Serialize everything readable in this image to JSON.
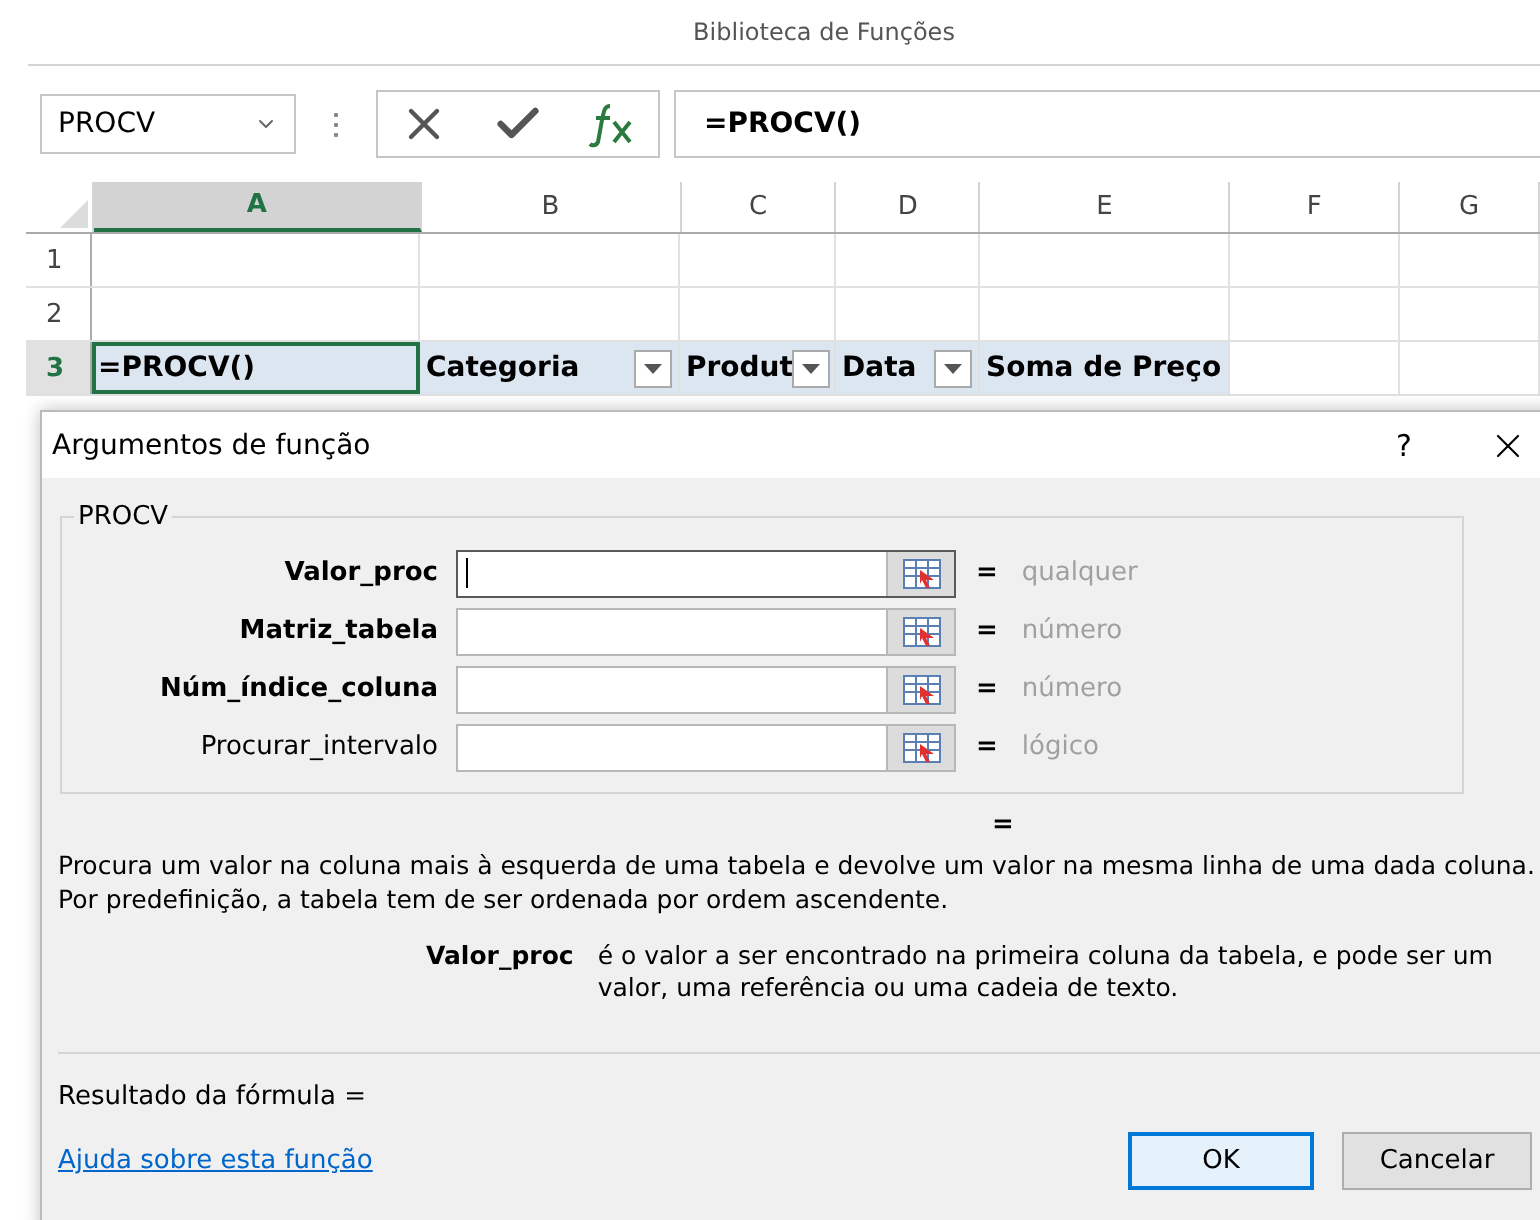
{
  "ribbon_group": "Biblioteca de Funções",
  "name_box": "PROCV",
  "formula_bar": {
    "value": "=PROCV()"
  },
  "columns": [
    {
      "label": "A",
      "selected": true
    },
    {
      "label": "B",
      "selected": false
    },
    {
      "label": "C",
      "selected": false
    },
    {
      "label": "D",
      "selected": false
    },
    {
      "label": "E",
      "selected": false
    },
    {
      "label": "F",
      "selected": false
    },
    {
      "label": "G",
      "selected": false
    }
  ],
  "rows": [
    {
      "number": "1",
      "selected": false,
      "cells": []
    },
    {
      "number": "2",
      "selected": false,
      "cells": []
    },
    {
      "number": "3",
      "selected": true,
      "cells": [
        {
          "text": "=PROCV()",
          "kind": "active"
        },
        {
          "text": "Categoria",
          "kind": "filter"
        },
        {
          "text": "Produt",
          "kind": "filter"
        },
        {
          "text": "Data",
          "kind": "filter"
        },
        {
          "text": "Soma de Preço",
          "kind": "header"
        }
      ]
    }
  ],
  "dialog": {
    "title": "Argumentos de função",
    "help": "?",
    "group_label": "PROCV",
    "arguments": [
      {
        "label": "Valor_proc",
        "bold": true,
        "equals": "=",
        "hint": "qualquer",
        "focused": true
      },
      {
        "label": "Matriz_tabela",
        "bold": true,
        "equals": "=",
        "hint": "número",
        "focused": false
      },
      {
        "label": "Núm_índice_coluna",
        "bold": true,
        "equals": "=",
        "hint": "número",
        "focused": false
      },
      {
        "label": "Procurar_intervalo",
        "bold": false,
        "equals": "=",
        "hint": "lógico",
        "focused": false
      }
    ],
    "result_equals": "=",
    "description": "Procura um valor na coluna mais à esquerda de uma tabela e devolve um valor na mesma linha de uma dada coluna. Por predefinição, a tabela tem de ser ordenada por ordem ascendente.",
    "argument_help": {
      "name": "Valor_proc",
      "text": "é o valor a ser encontrado na primeira coluna da tabela, e pode ser um valor, uma referência ou uma cadeia de texto."
    },
    "result_label": "Resultado da fórmula =",
    "help_link": "Ajuda sobre esta função",
    "buttons": [
      {
        "label": "OK",
        "default": true
      },
      {
        "label": "Cancelar",
        "default": false
      }
    ]
  }
}
